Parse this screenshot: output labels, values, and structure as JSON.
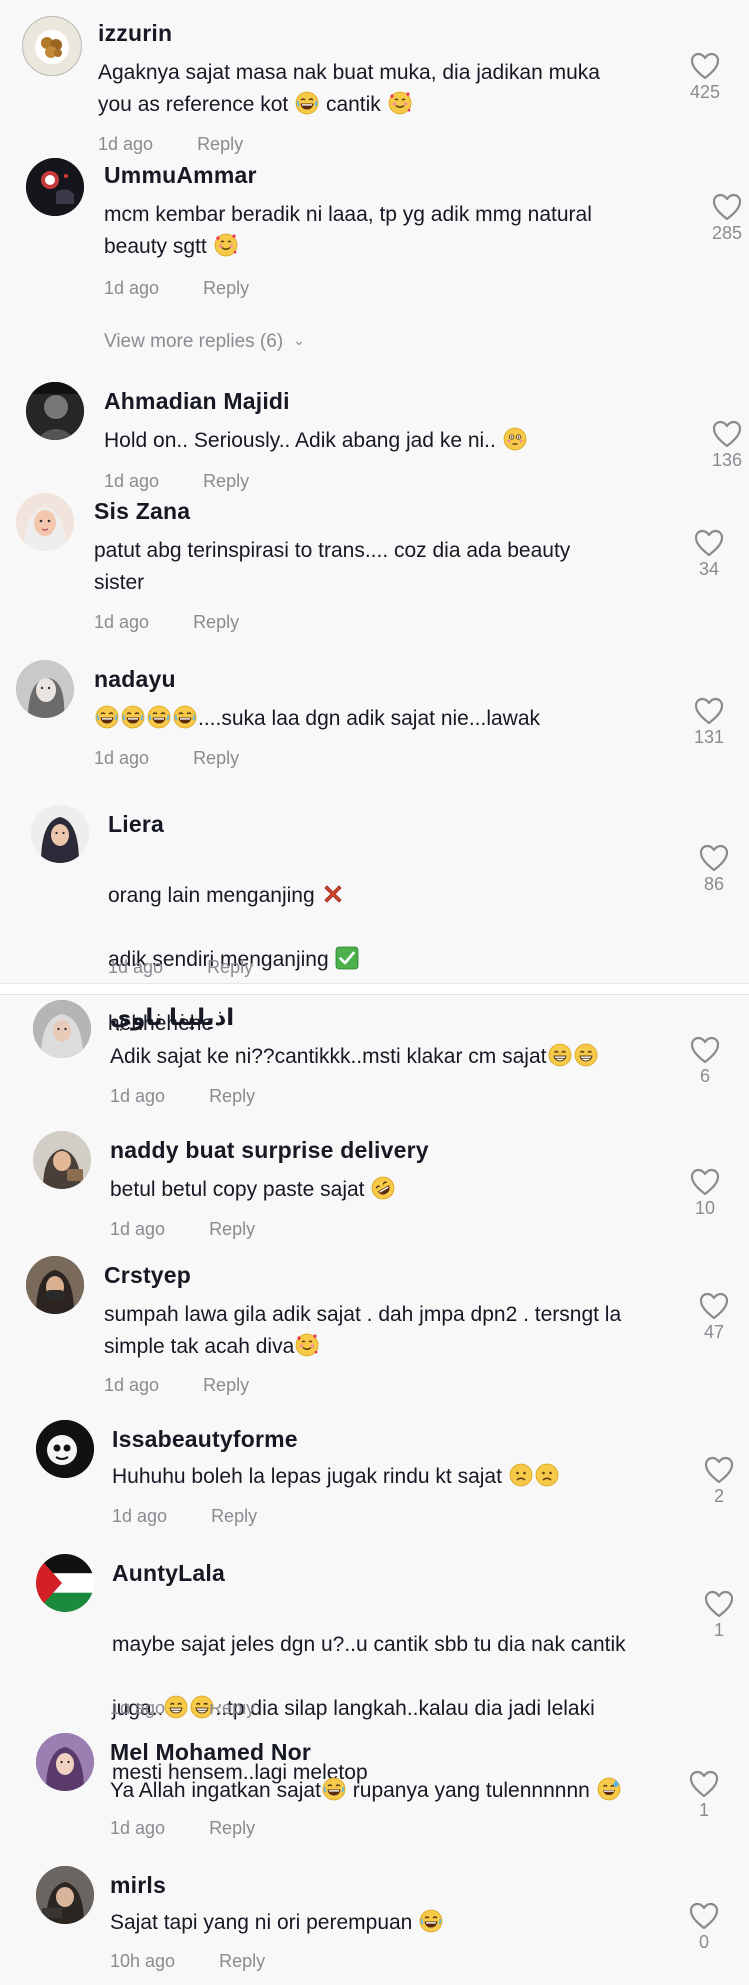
{
  "reply_label": "Reply",
  "view_more_label": "View more replies (6)",
  "comments": [
    {
      "username": "izzurin",
      "text_before": "Agaknya sajat masa nak buat muka, dia jadikan muka\nyou as reference kot ",
      "emoji1": "😂",
      "text_mid": " cantik ",
      "emoji2": "🥰",
      "time": "1d ago",
      "likes": "425"
    },
    {
      "username": "UmmuAmmar",
      "text_before": "mcm kembar beradik ni laaa, tp yg adik mmg natural\nbeauty sgtt ",
      "emoji1": "🥰",
      "time": "1d ago",
      "likes": "285"
    },
    {
      "username": "Ahmadian Majidi",
      "text_before": "Hold on.. Seriously.. Adik abang jad ke ni.. ",
      "emoji1": "😳",
      "time": "1d ago",
      "likes": "136"
    },
    {
      "username": "Sis Zana",
      "text_before": "patut abg terinspirasi to trans.... coz dia ada beauty\nsister",
      "time": "1d ago",
      "likes": "34"
    },
    {
      "username": "nadayu",
      "emojis": "😂😂😂😂",
      "text_after": "....suka laa dgn adik sajat nie...lawak",
      "time": "1d ago",
      "likes": "131"
    },
    {
      "username": "Liera",
      "line1": "orang lain menganjing ",
      "line1_emoji": "❌",
      "line2": "adik sendiri menganjing ",
      "line2_emoji": "✅",
      "line3": "hehhehehe",
      "time": "1d ago",
      "likes": "86"
    },
    {
      "username": "اذيلينا ناوي",
      "text_before": "Adik sajat ke ni??cantikkk..msti klakar cm sajat",
      "emojis": "😁😁",
      "time": "1d ago",
      "likes": "6"
    },
    {
      "username": "naddy buat surprise delivery",
      "text_before": "betul betul copy paste sajat ",
      "emoji1": "🤣",
      "time": "1d ago",
      "likes": "10"
    },
    {
      "username": "Crstyep",
      "text_before": "sumpah lawa gila adik sajat . dah jmpa dpn2 . tersngt la\nsimple tak acah diva",
      "emoji1": "🥰",
      "time": "1d ago",
      "likes": "47"
    },
    {
      "username": "Issabeautyforme",
      "text_before": "Huhuhu boleh la lepas jugak rindu kt sajat ",
      "emojis": "🙁🙁",
      "time": "1d ago",
      "likes": "2"
    },
    {
      "username": "AuntyLala",
      "line1": "maybe sajat jeles dgn u?..u cantik sbb tu dia nak cantik",
      "line2a": "juga..",
      "line2_emojis": "😁😁",
      "line2b": "..tp dia silap langkah..kalau dia jadi lelaki",
      "line3": "mesti hensem..lagi meletop",
      "time": "1d ago",
      "likes": "1"
    },
    {
      "username": "Mel Mohamed Nor",
      "text_before": "Ya Allah ingatkan sajat",
      "emoji1": "😂",
      "text_mid": " rupanya yang tulennnnnn ",
      "emoji2": "😅",
      "time": "1d ago",
      "likes": "1"
    },
    {
      "username": "mirls",
      "text_before": "Sajat tapi yang ni ori perempuan ",
      "emoji1": "😂",
      "time": "10h ago",
      "likes": "0"
    }
  ],
  "colors": {
    "background": "#f8f8f8",
    "text": "#161823",
    "muted": "#8a8b91"
  }
}
